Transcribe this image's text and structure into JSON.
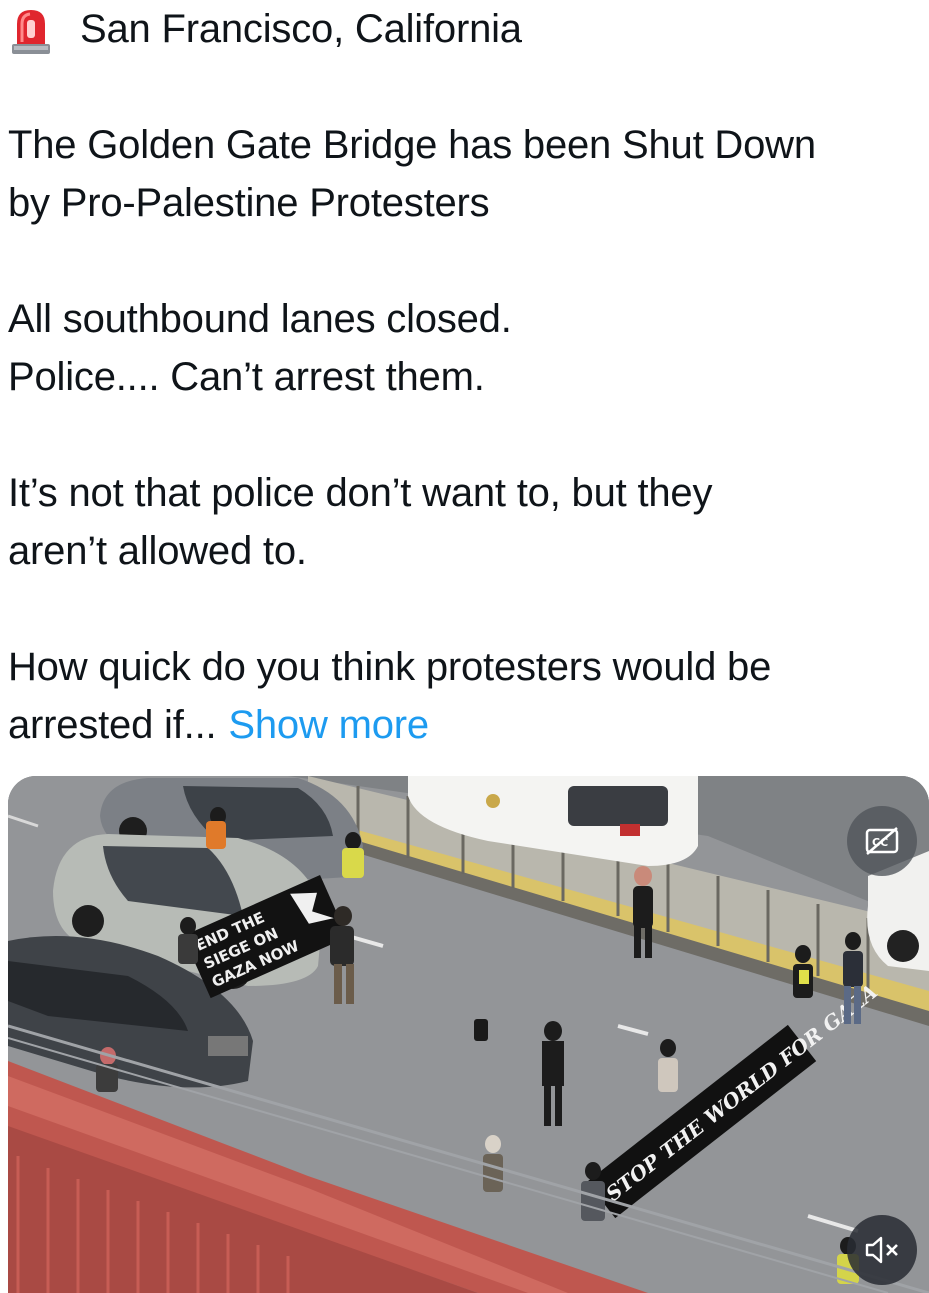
{
  "tweet": {
    "location_icon": "police-siren-emoji",
    "location": "San Francisco, California",
    "headline_line1": "The Golden Gate Bridge has been Shut Down",
    "headline_line2": "by Pro-Palestine Protesters",
    "para2_line1": "All southbound lanes closed.",
    "para2_line2": "Police.... Can’t arrest them.",
    "para3_line1": "It’s not that police don’t want to, but they",
    "para3_line2": "aren’t allowed to.",
    "para4_line1": "How quick do you think protesters would be",
    "para4_line2": "arrested if...",
    "show_more": "Show more"
  },
  "media": {
    "description_icon": "video-thumbnail",
    "banner_left": [
      "END THE",
      "SIEGE ON",
      "GAZA NOW"
    ],
    "banner_right": "STOP THE WORLD FOR GAZA",
    "cc_icon": "closed-captions-off-icon",
    "mute_icon": "speaker-muted-icon"
  },
  "colors": {
    "link": "#1d9bf0",
    "text": "#0f1419",
    "bridge_red": "#c0504a"
  }
}
